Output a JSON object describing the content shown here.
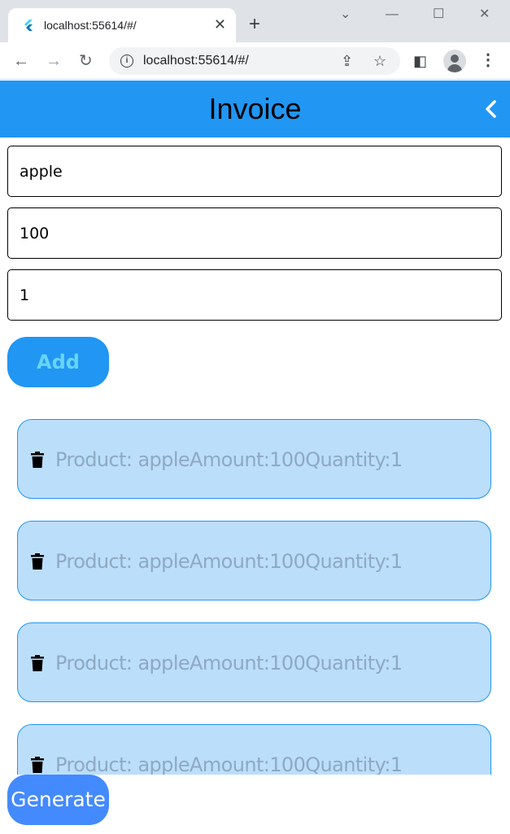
{
  "browser": {
    "tab_title": "localhost:55614/#/",
    "tab_close": "✕",
    "new_tab": "+",
    "url": "localhost:55614/#/",
    "back": "←",
    "forward": "→",
    "reload": "↻",
    "minimize": "—",
    "maximize": "☐",
    "close": "✕",
    "tablist": "⌄",
    "share": "⇪",
    "star": "☆",
    "sidepanel": "◧",
    "menu": "⋮",
    "info": "i"
  },
  "app": {
    "title": "Invoice",
    "primary_color": "#2196f3",
    "fields": [
      {
        "name": "product",
        "value": "apple"
      },
      {
        "name": "amount",
        "value": "100"
      },
      {
        "name": "quantity",
        "value": "1"
      }
    ],
    "add_label": "Add",
    "generate_label": "Generate",
    "items": [
      {
        "text": "Product: appleAmount:100Quantity:1"
      },
      {
        "text": "Product: appleAmount:100Quantity:1"
      },
      {
        "text": "Product: appleAmount:100Quantity:1"
      },
      {
        "text": "Product: appleAmount:100Quantity:1"
      }
    ]
  }
}
